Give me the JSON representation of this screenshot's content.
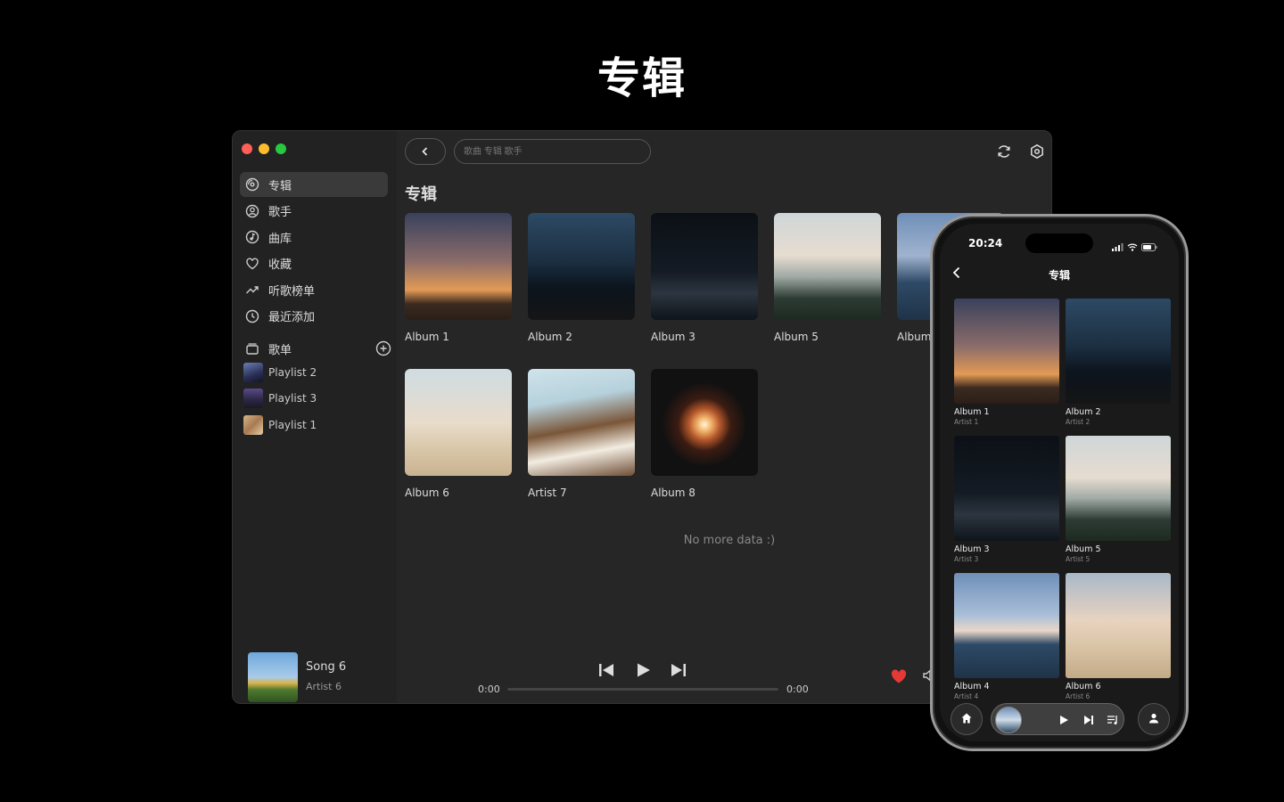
{
  "hero": {
    "title": "专辑"
  },
  "desktop": {
    "sidebar": {
      "items": [
        {
          "label": "专辑",
          "icon": "album-icon"
        },
        {
          "label": "歌手",
          "icon": "artist-icon"
        },
        {
          "label": "曲库",
          "icon": "music-library-icon"
        },
        {
          "label": "收藏",
          "icon": "heart-icon"
        },
        {
          "label": "听歌榜单",
          "icon": "trending-icon"
        },
        {
          "label": "最近添加",
          "icon": "clock-icon"
        }
      ],
      "playlists_label": "歌单",
      "playlists": [
        "Playlist 2",
        "Playlist 3",
        "Playlist 1"
      ]
    },
    "search": {
      "placeholder": "歌曲 专辑 歌手"
    },
    "section_title": "专辑",
    "albums": [
      "Album 1",
      "Album 2",
      "Album 3",
      "Album 5",
      "Album",
      "Album 6",
      "Artist 7",
      "Album 8"
    ],
    "no_more": "No more data :)",
    "player": {
      "song": "Song 6",
      "artist": "Artist 6",
      "current_time": "0:00",
      "total_time": "0:00",
      "progress": 0
    }
  },
  "phone": {
    "time": "20:24",
    "title": "专辑",
    "albums": [
      {
        "title": "Album 1",
        "artist": "Artist 1"
      },
      {
        "title": "Album 2",
        "artist": "Artist 2"
      },
      {
        "title": "Album 3",
        "artist": "Artist 3"
      },
      {
        "title": "Album 5",
        "artist": "Artist 5"
      },
      {
        "title": "Album 4",
        "artist": "Artist 4"
      },
      {
        "title": "Album 6",
        "artist": "Artist 6"
      }
    ]
  },
  "colors": {
    "accent_red": "#e53935",
    "bg": "#000000",
    "window": "#262626"
  }
}
